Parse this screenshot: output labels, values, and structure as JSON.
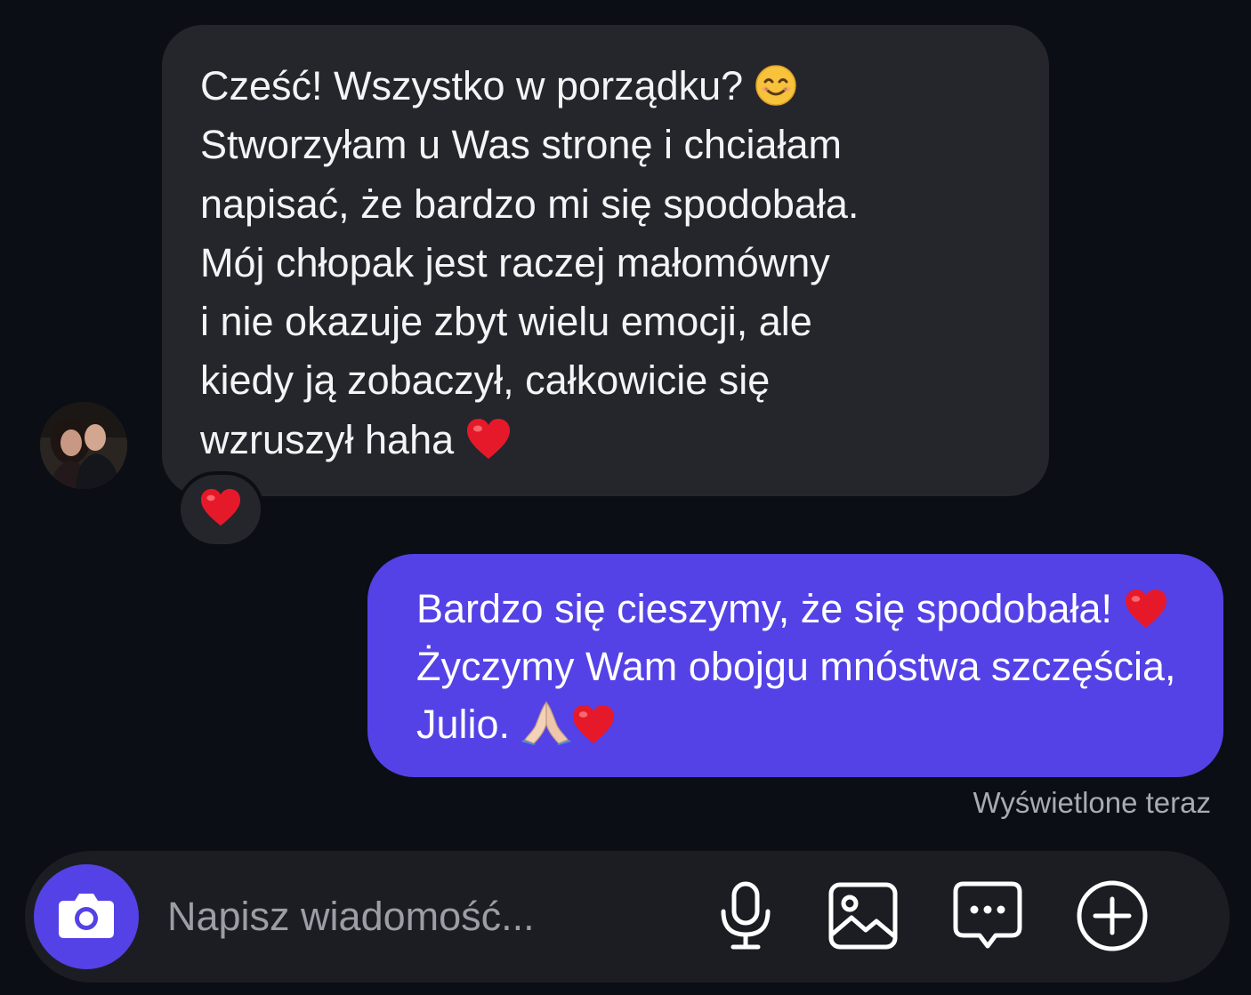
{
  "incoming_message": {
    "lines": [
      "Cześć! Wszystko w porządku? ",
      "Stworzyłam u Was stronę i chciałam",
      "napisać, że bardzo mi się spodobała.",
      "Mój chłopak jest raczej małomówny",
      "i nie okazuje zbyt wielu emocji, ale",
      "kiedy ją zobaczył, całkowicie się",
      "wzruszył haha "
    ],
    "reaction": "heart-emoji"
  },
  "outgoing_message": {
    "lines": [
      "Bardzo się cieszymy, że się spodobała! ",
      "Życzymy Wam obojgu mnóstwa szczęścia,",
      "Julio. "
    ]
  },
  "read_receipt": "Wyświetlone teraz",
  "composer": {
    "placeholder": "Napisz wiadomość..."
  },
  "colors": {
    "background": "#0b0e14",
    "incoming_bubble": "#25262b",
    "outgoing_bubble": "#5442e6",
    "composer": "#1c1d23",
    "accent": "#5442e6"
  },
  "icons": [
    "camera-icon",
    "microphone-icon",
    "image-icon",
    "message-dots-icon",
    "plus-circle-icon",
    "smile-emoji",
    "heart-emoji",
    "pray-emoji"
  ]
}
